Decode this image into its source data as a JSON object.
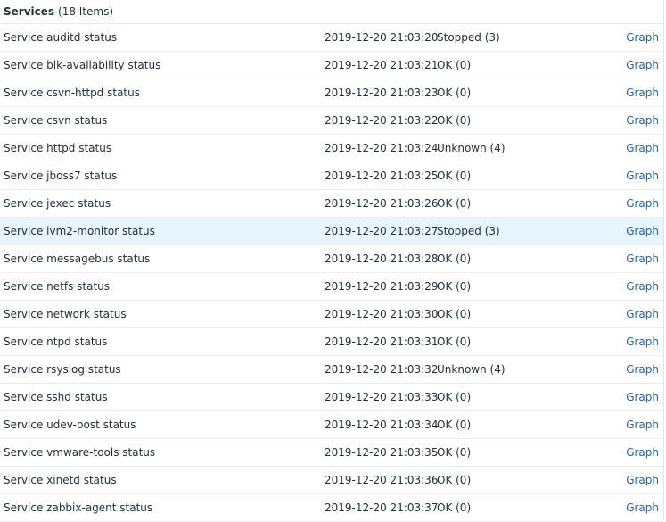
{
  "group": {
    "name": "Services",
    "count": "(18 Items)"
  },
  "rows": [
    {
      "name": "Service auditd status",
      "time": "2019-12-20 21:03:20",
      "value": "Stopped (3)",
      "link": "Graph"
    },
    {
      "name": "Service blk-availability status",
      "time": "2019-12-20 21:03:21",
      "value": "OK (0)",
      "link": "Graph"
    },
    {
      "name": "Service csvn-httpd status",
      "time": "2019-12-20 21:03:23",
      "value": "OK (0)",
      "link": "Graph"
    },
    {
      "name": "Service csvn status",
      "time": "2019-12-20 21:03:22",
      "value": "OK (0)",
      "link": "Graph"
    },
    {
      "name": "Service httpd status",
      "time": "2019-12-20 21:03:24",
      "value": "Unknown (4)",
      "link": "Graph"
    },
    {
      "name": "Service jboss7 status",
      "time": "2019-12-20 21:03:25",
      "value": "OK (0)",
      "link": "Graph"
    },
    {
      "name": "Service jexec status",
      "time": "2019-12-20 21:03:26",
      "value": "OK (0)",
      "link": "Graph"
    },
    {
      "name": "Service lvm2-monitor status",
      "time": "2019-12-20 21:03:27",
      "value": "Stopped (3)",
      "link": "Graph",
      "highlighted": true
    },
    {
      "name": "Service messagebus status",
      "time": "2019-12-20 21:03:28",
      "value": "OK (0)",
      "link": "Graph"
    },
    {
      "name": "Service netfs status",
      "time": "2019-12-20 21:03:29",
      "value": "OK (0)",
      "link": "Graph"
    },
    {
      "name": "Service network status",
      "time": "2019-12-20 21:03:30",
      "value": "OK (0)",
      "link": "Graph"
    },
    {
      "name": "Service ntpd status",
      "time": "2019-12-20 21:03:31",
      "value": "OK (0)",
      "link": "Graph"
    },
    {
      "name": "Service rsyslog status",
      "time": "2019-12-20 21:03:32",
      "value": "Unknown (4)",
      "link": "Graph"
    },
    {
      "name": "Service sshd status",
      "time": "2019-12-20 21:03:33",
      "value": "OK (0)",
      "link": "Graph"
    },
    {
      "name": "Service udev-post status",
      "time": "2019-12-20 21:03:34",
      "value": "OK (0)",
      "link": "Graph"
    },
    {
      "name": "Service vmware-tools status",
      "time": "2019-12-20 21:03:35",
      "value": "OK (0)",
      "link": "Graph"
    },
    {
      "name": "Service xinetd status",
      "time": "2019-12-20 21:03:36",
      "value": "OK (0)",
      "link": "Graph"
    },
    {
      "name": "Service zabbix-agent status",
      "time": "2019-12-20 21:03:37",
      "value": "OK (0)",
      "link": "Graph"
    }
  ],
  "colors": {
    "link": "#1f65a6",
    "highlight_row": "#e8f5ff",
    "row_border": "#ebeef0",
    "text": "#1f2c33"
  }
}
